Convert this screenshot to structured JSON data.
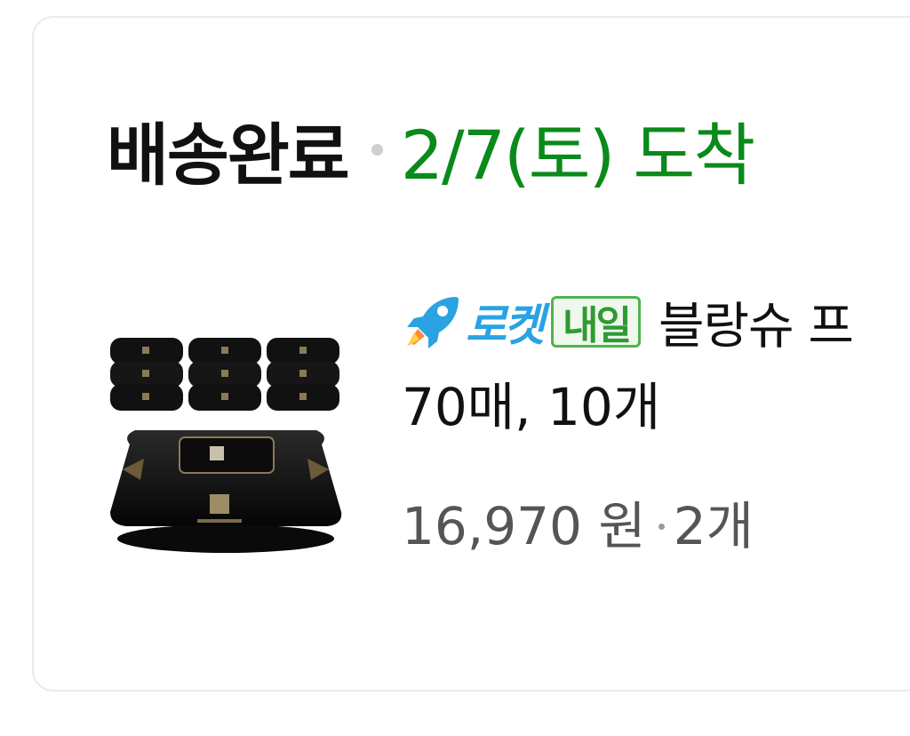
{
  "order": {
    "status": "배송완료",
    "arrival_text": "2/7(토) 도착",
    "colors": {
      "status": "#111111",
      "arrival": "#0a8a1a",
      "rocket": "#29a3e4",
      "badge_border": "#4fb34e",
      "badge_text": "#2f9a33"
    }
  },
  "product": {
    "image_icon": "wet-wipes-product-image",
    "delivery_icon": "rocket-icon",
    "delivery_label": "로켓",
    "delivery_badge": "내일",
    "name": "블랑슈 프",
    "option": "70매, 10개",
    "price": "16,970 원",
    "quantity": "2개"
  }
}
